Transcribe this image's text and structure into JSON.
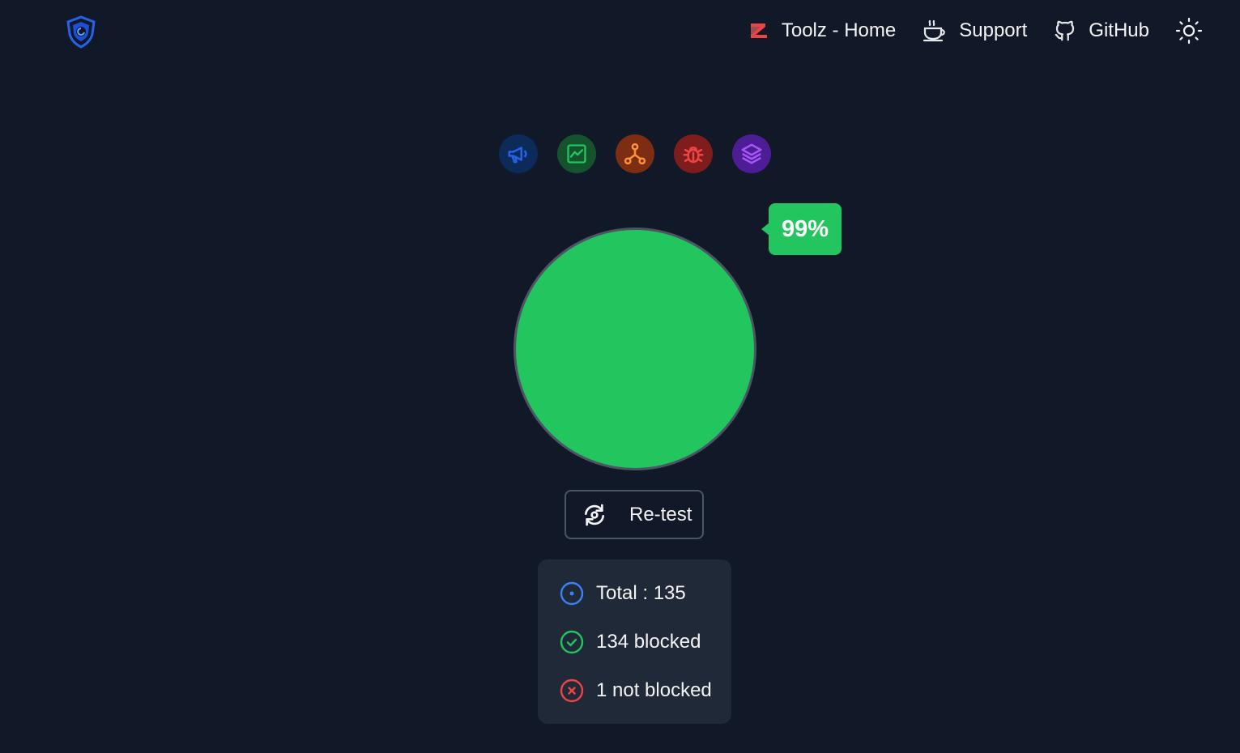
{
  "header": {
    "logo_icon": "shield-icon",
    "nav": [
      {
        "icon": "toolz-logo-icon",
        "label": "Toolz - Home"
      },
      {
        "icon": "coffee-icon",
        "label": "Support"
      },
      {
        "icon": "github-icon",
        "label": "GitHub"
      }
    ],
    "theme_toggle_icon": "sun-icon"
  },
  "categories": [
    {
      "icon": "megaphone-icon",
      "color": "#1e40af"
    },
    {
      "icon": "chart-icon",
      "color": "#15803d"
    },
    {
      "icon": "network-icon",
      "color": "#c2410c"
    },
    {
      "icon": "bug-icon",
      "color": "#b91c1c"
    },
    {
      "icon": "layers-icon",
      "color": "#6d28d9"
    }
  ],
  "result": {
    "percent_label": "99%",
    "circle_color": "#22c55e"
  },
  "retest": {
    "label": "Re-test",
    "icon": "refresh-icon"
  },
  "stats": {
    "total": "Total : 135",
    "blocked": "134 blocked",
    "not_blocked": "1 not blocked"
  }
}
